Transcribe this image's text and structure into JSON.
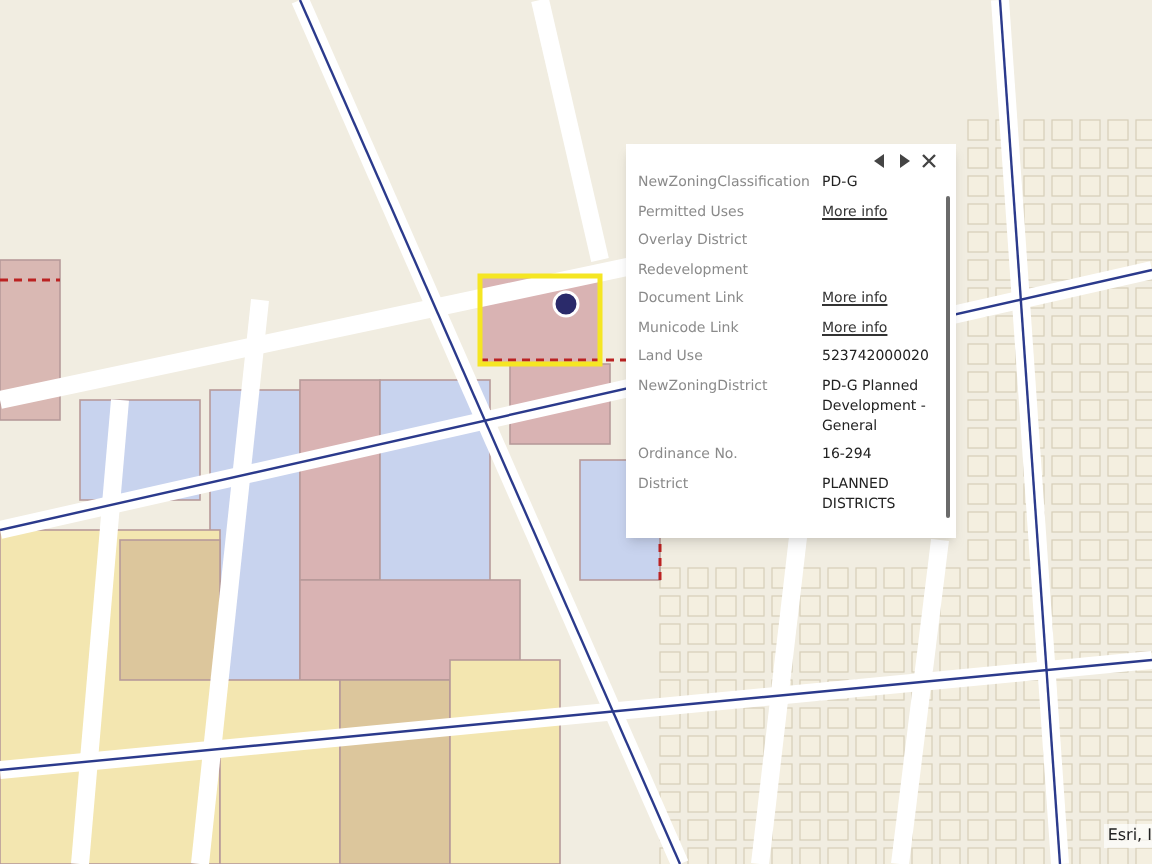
{
  "popup": {
    "fields": [
      {
        "label": "NewZoningClassification",
        "kind": "text",
        "value": "PD-G"
      },
      {
        "label": "Permitted Uses",
        "kind": "link",
        "value": "More info"
      },
      {
        "label": "Overlay District"
      },
      {
        "label": "Redevelopment"
      },
      {
        "label": "Document Link",
        "kind": "link",
        "value": "More info"
      },
      {
        "label": "Municode Link",
        "kind": "link",
        "value": "More info"
      },
      {
        "label": "Land Use",
        "kind": "text",
        "value": "523742000020"
      },
      {
        "label": "NewZoningDistrict",
        "kind": "text",
        "value": "PD-G Planned Development - General"
      },
      {
        "label": "Ordinance No.",
        "kind": "text",
        "value": "16-294"
      },
      {
        "label": "District",
        "kind": "text",
        "value": "PLANNED DISTRICTS"
      }
    ]
  },
  "attribution": "Esri, I"
}
